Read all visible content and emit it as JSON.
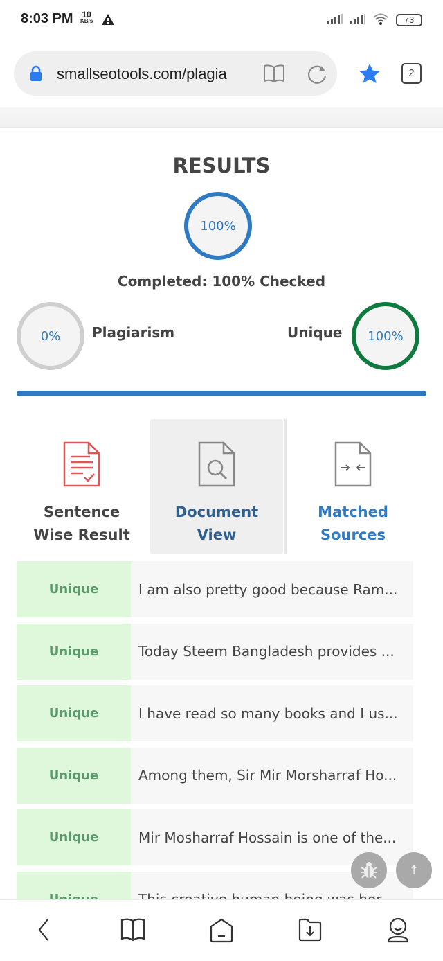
{
  "status_bar": {
    "time": "8:03 PM",
    "speed": "10",
    "speed_unit": "KB/s",
    "battery": "73"
  },
  "browser": {
    "url": "smallseotools.com/plagia",
    "tab_count": "2"
  },
  "results": {
    "title": "RESULTS",
    "progress": "100%",
    "completed": "Completed: 100% Checked",
    "plagiarism_value": "0%",
    "plagiarism_label": "Plagiarism",
    "unique_label": "Unique",
    "unique_value": "100%",
    "progress_fraction": 1.0
  },
  "tabs": [
    {
      "label1": "Sentence",
      "label2": "Wise Result"
    },
    {
      "label1": "Document",
      "label2": "View"
    },
    {
      "label1": "Matched",
      "label2": "Sources"
    }
  ],
  "rows": [
    {
      "status": "Unique",
      "text": "I am also pretty good because Ram..."
    },
    {
      "status": "Unique",
      "text": "Today Steem Bangladesh provides ..."
    },
    {
      "status": "Unique",
      "text": "I have read so many books and I us..."
    },
    {
      "status": "Unique",
      "text": "Among them, Sir Mir Morsharraf Ho..."
    },
    {
      "status": "Unique",
      "text": "Mir Mosharraf Hossain is one of the..."
    },
    {
      "status": "Unique",
      "text": "This creative human being was bor..."
    }
  ],
  "colors": {
    "blue": "#2f7ac0",
    "green": "#0f7a3e",
    "unique_bg": "#dff7db"
  }
}
